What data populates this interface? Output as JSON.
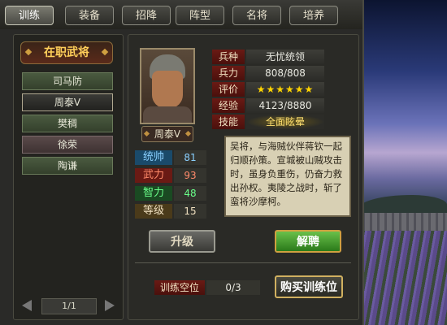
{
  "tabs": [
    "训练",
    "装备",
    "招降",
    "阵型",
    "名将",
    "培养"
  ],
  "left_panel": {
    "title": "在职武将",
    "generals": [
      "司马防",
      "周泰V",
      "樊稠",
      "徐荣",
      "陶谦"
    ],
    "page": "1/1"
  },
  "general": {
    "name": "周泰V",
    "info": [
      {
        "key": "兵种",
        "value": "无忧统领"
      },
      {
        "key": "兵力",
        "value": "808/808"
      },
      {
        "key": "评价",
        "value": "★★★★★★"
      },
      {
        "key": "经验",
        "value": "4123/8880"
      },
      {
        "key": "技能",
        "value": "全面眩晕"
      }
    ],
    "stats": [
      {
        "key": "统帅",
        "value": "81"
      },
      {
        "key": "武力",
        "value": "93"
      },
      {
        "key": "智力",
        "value": "48"
      },
      {
        "key": "等级",
        "value": "15"
      }
    ],
    "bio": "吴将，与海贼伙伴蒋钦一起归顺孙策。宣城被山贼攻击时，虽身负重伤，仍奋力救出孙权。夷陵之战时，斩了蛮将沙摩柯。"
  },
  "buttons": {
    "upgrade": "升级",
    "dismiss": "解聘",
    "buy_slot": "购买训练位"
  },
  "training_slots": {
    "label": "训练空位",
    "value": "0/3"
  }
}
